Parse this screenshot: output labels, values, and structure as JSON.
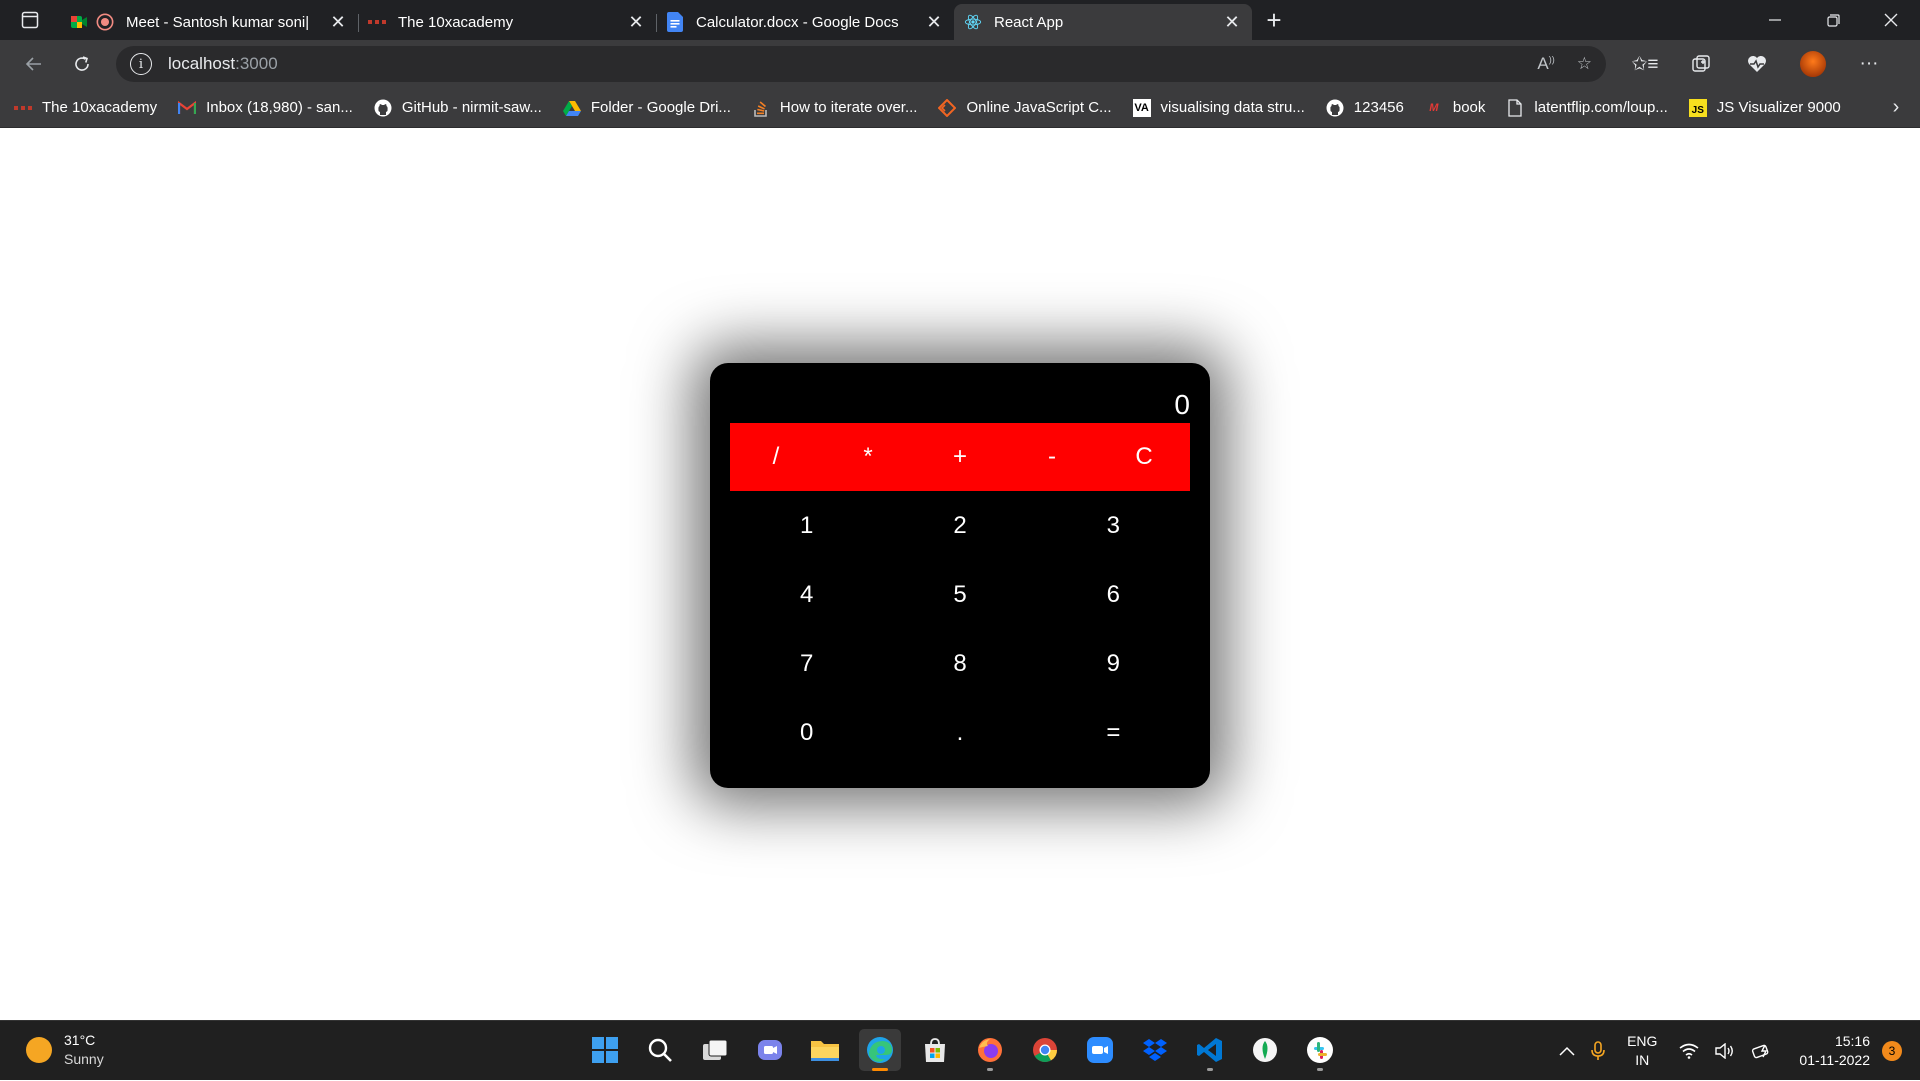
{
  "browser": {
    "tabs": [
      {
        "title": "Meet - Santosh kumar soni|",
        "icon": "meet-icon",
        "recording": true
      },
      {
        "title": "The 10xacademy",
        "icon": "10x-icon"
      },
      {
        "title": "Calculator.docx - Google Docs",
        "icon": "docs-icon"
      },
      {
        "title": "React App",
        "icon": "react-icon",
        "active": true
      }
    ],
    "address": {
      "host": "localhost",
      "port": ":3000"
    },
    "bookmarks": [
      {
        "label": "The 10xacademy",
        "icon": "10x-icon"
      },
      {
        "label": "Inbox (18,980) - san...",
        "icon": "gmail-icon"
      },
      {
        "label": "GitHub - nirmit-saw...",
        "icon": "github-icon"
      },
      {
        "label": "Folder - Google Dri...",
        "icon": "drive-icon"
      },
      {
        "label": "How to iterate over...",
        "icon": "so-icon"
      },
      {
        "label": "Online JavaScript C...",
        "icon": "js-compiler-icon"
      },
      {
        "label": "visualising data stru...",
        "icon": "visualgo-icon"
      },
      {
        "label": "123456",
        "icon": "github-icon"
      },
      {
        "label": "book",
        "icon": "book-icon"
      },
      {
        "label": "latentflip.com/loup...",
        "icon": "page-icon"
      },
      {
        "label": "JS Visualizer 9000",
        "icon": "js-icon"
      }
    ]
  },
  "calculator": {
    "display": "0",
    "operators": [
      "/",
      "*",
      "+",
      "-",
      "C"
    ],
    "keys": [
      "1",
      "2",
      "3",
      "4",
      "5",
      "6",
      "7",
      "8",
      "9",
      "0",
      ".",
      "="
    ],
    "colors": {
      "body": "#000000",
      "operator_row": "#ff0000",
      "text": "#ffffff"
    }
  },
  "taskbar": {
    "weather": {
      "temp": "31°C",
      "condition": "Sunny"
    },
    "apps": [
      "windows-start-icon",
      "search-icon",
      "task-view-icon",
      "teams-chat-icon",
      "file-explorer-icon",
      "edge-icon",
      "store-icon",
      "firefox-icon",
      "chrome-icon",
      "zoom-icon",
      "dropbox-icon",
      "vscode-icon",
      "mongodb-compass-icon",
      "slack-icon"
    ],
    "language": {
      "line1": "ENG",
      "line2": "IN"
    },
    "clock": {
      "time": "15:16",
      "date": "01-11-2022"
    },
    "notifications": "3"
  }
}
